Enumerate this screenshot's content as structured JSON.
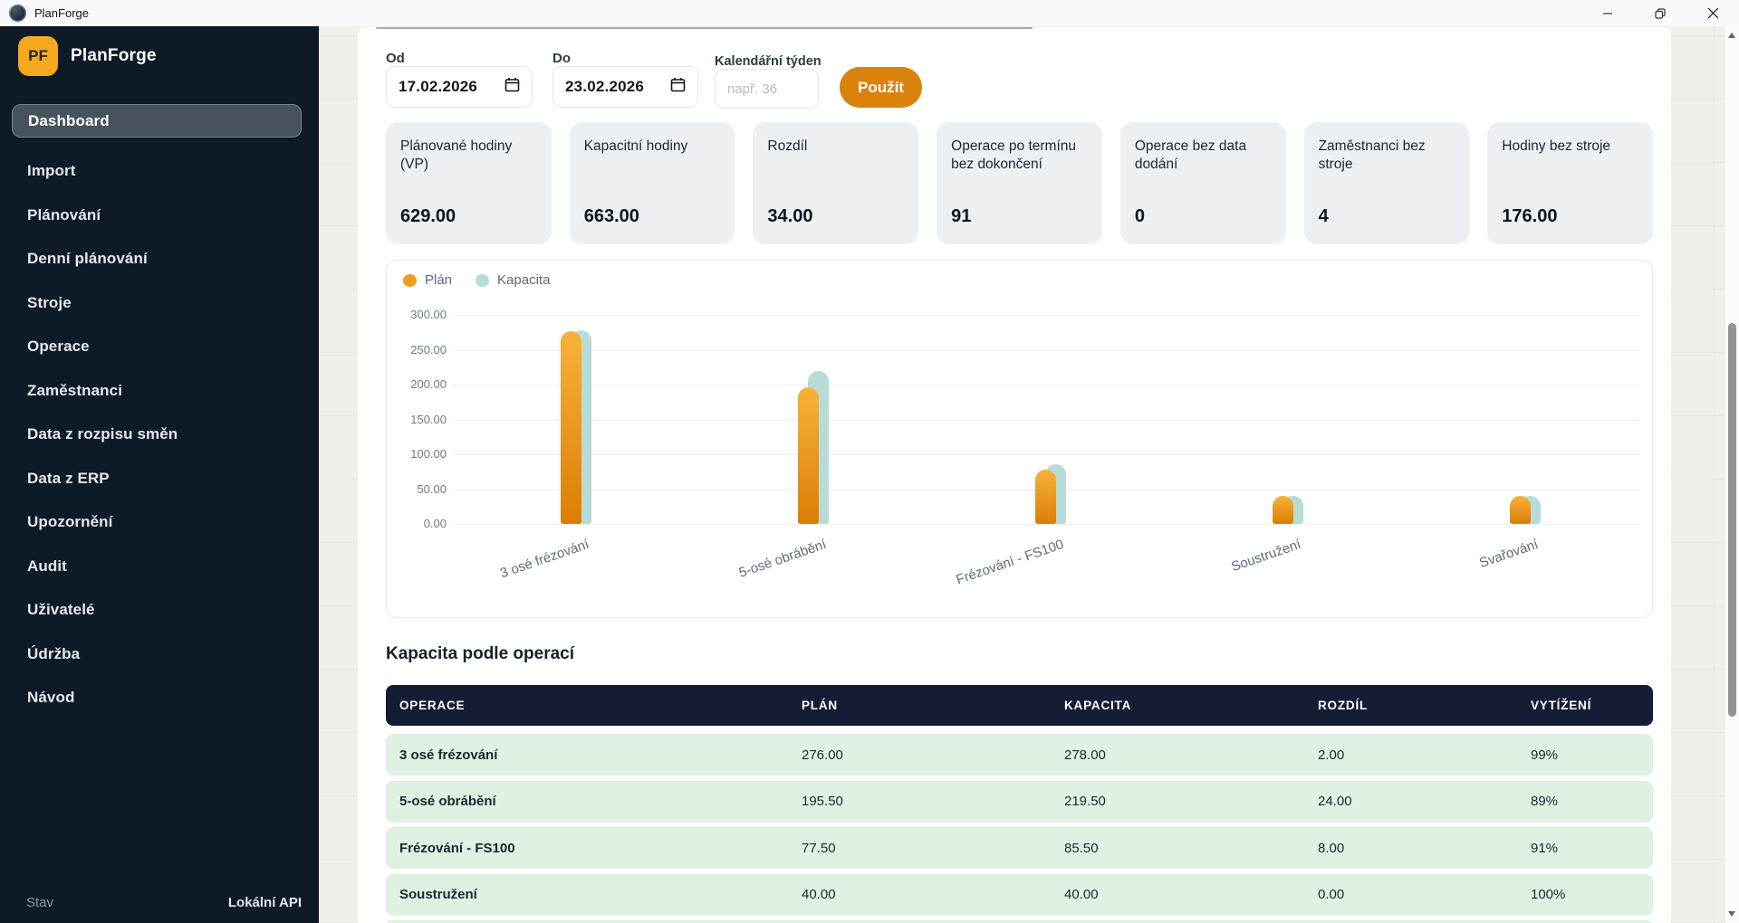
{
  "window": {
    "title": "PlanForge"
  },
  "sidebar": {
    "logo_initials": "PF",
    "app_name": "PlanForge",
    "items": [
      {
        "label": "Dashboard",
        "active": true
      },
      {
        "label": "Import"
      },
      {
        "label": "Plánování"
      },
      {
        "label": "Denní plánování"
      },
      {
        "label": "Stroje"
      },
      {
        "label": "Operace"
      },
      {
        "label": "Zaměstnanci"
      },
      {
        "label": "Data z rozpisu směn"
      },
      {
        "label": "Data z ERP"
      },
      {
        "label": "Upozornění"
      },
      {
        "label": "Audit"
      },
      {
        "label": "Uživatelé"
      },
      {
        "label": "Údržba"
      },
      {
        "label": "Návod"
      }
    ],
    "footer": {
      "status": "Stav",
      "api": "Lokální API"
    }
  },
  "filters": {
    "from_label": "Od",
    "from_value": "17.02.2026",
    "to_label": "Do",
    "to_value": "23.02.2026",
    "week_label": "Kalendářní týden",
    "week_placeholder": "např. 36",
    "apply_label": "Použít"
  },
  "kpis": [
    {
      "label": "Plánované hodiny (VP)",
      "value": "629.00"
    },
    {
      "label": "Kapacitní hodiny",
      "value": "663.00"
    },
    {
      "label": "Rozdíl",
      "value": "34.00"
    },
    {
      "label": "Operace po termínu bez dokončení",
      "value": "91"
    },
    {
      "label": "Operace bez data dodání",
      "value": "0"
    },
    {
      "label": "Zaměstnanci bez stroje",
      "value": "4"
    },
    {
      "label": "Hodiny bez stroje",
      "value": "176.00"
    }
  ],
  "chart_data": {
    "type": "bar",
    "categories": [
      "3 osé frézování",
      "5-osé obrábění",
      "Frézování - FS100",
      "Soustružení",
      "Svařování"
    ],
    "series": [
      {
        "name": "Plán",
        "color": "#f09c1c",
        "values": [
          276,
          195.5,
          77.5,
          40,
          40
        ]
      },
      {
        "name": "Kapacita",
        "color": "#b7dcd8",
        "values": [
          278,
          219.5,
          85.5,
          40,
          40
        ]
      }
    ],
    "ylim": [
      0,
      300
    ],
    "ytick_step": 50,
    "ytick_labels": [
      "300.00",
      "250.00",
      "200.00",
      "150.00",
      "100.00",
      "50.00",
      "0.00"
    ],
    "legend_position": "top-left",
    "grid": "horizontal"
  },
  "table": {
    "title": "Kapacita podle operací",
    "columns": [
      "OPERACE",
      "PLÁN",
      "KAPACITA",
      "ROZDÍL",
      "VYTÍŽENÍ"
    ],
    "rows": [
      [
        "3 osé frézování",
        "276.00",
        "278.00",
        "2.00",
        "99%"
      ],
      [
        "5-osé obrábění",
        "195.50",
        "219.50",
        "24.00",
        "89%"
      ],
      [
        "Frézování - FS100",
        "77.50",
        "85.50",
        "8.00",
        "91%"
      ],
      [
        "Soustružení",
        "40.00",
        "40.00",
        "0.00",
        "100%"
      ]
    ],
    "has_partial_row": true
  },
  "colors": {
    "accent_orange": "#d9830d",
    "bar_plan_top": "#f7b23a",
    "bar_plan_bottom": "#db7e04",
    "bar_capacity": "#b7dcd8",
    "sidebar_bg": "#0e1b26",
    "table_header_bg": "#141d33",
    "table_row_bg": "#dff1e2",
    "kpi_card_bg": "#edf0f3",
    "content_bg": "#f1efe9"
  }
}
